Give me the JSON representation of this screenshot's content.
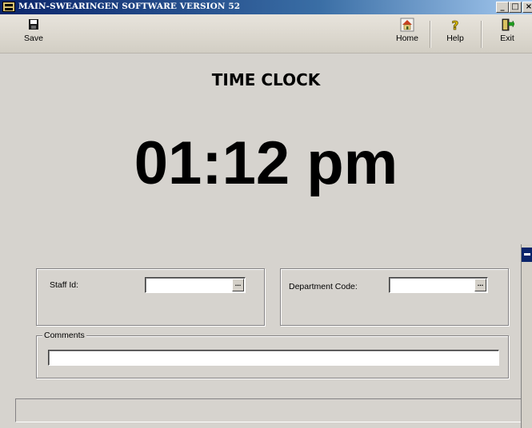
{
  "window": {
    "title": "MAIN-SWEARINGEN SOFTWARE VERSION 52",
    "controls": {
      "minimize": "_",
      "maximize": "□",
      "close": "×"
    }
  },
  "toolbar": {
    "save_label": "Save",
    "home_label": "Home",
    "help_label": "Help",
    "exit_label": "Exit"
  },
  "main": {
    "heading": "TIME CLOCK",
    "time": "01:12 pm"
  },
  "form": {
    "staff_id_label": "Staff Id:",
    "staff_id_value": "",
    "department_code_label": "Department Code:",
    "department_code_value": "",
    "lookup_button": "...",
    "comments_label": "Comments",
    "comments_value": ""
  },
  "colors": {
    "titlebar_start": "#0a246a",
    "titlebar_end": "#a6caf0",
    "background": "#d6d3ce"
  }
}
